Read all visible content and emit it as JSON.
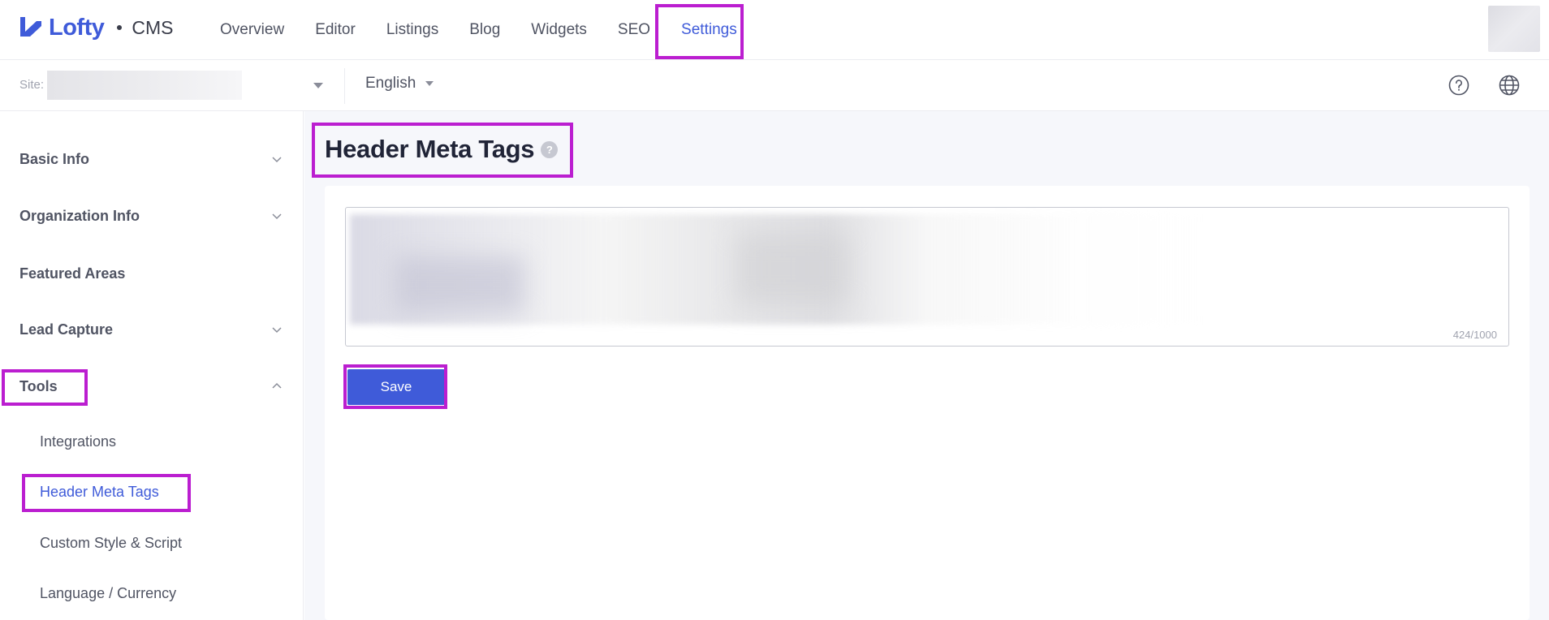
{
  "app": {
    "logo_text": "Lofty",
    "product": "CMS",
    "brand_color": "#3f5bd9",
    "highlight_color": "#bb1ed0"
  },
  "nav": {
    "items": [
      {
        "label": "Overview"
      },
      {
        "label": "Editor"
      },
      {
        "label": "Listings"
      },
      {
        "label": "Blog"
      },
      {
        "label": "Widgets"
      },
      {
        "label": "SEO"
      },
      {
        "label": "Settings",
        "active": true
      }
    ]
  },
  "subbar": {
    "site_label": "Site:",
    "language": "English",
    "help_icon": "help-circle-icon",
    "globe_icon": "globe-icon"
  },
  "sidebar": {
    "groups": [
      {
        "label": "Basic Info",
        "icon": "chevron-down-icon"
      },
      {
        "label": "Organization Info",
        "icon": "chevron-down-icon"
      },
      {
        "label": "Featured Areas"
      },
      {
        "label": "Lead Capture",
        "icon": "chevron-down-icon"
      },
      {
        "label": "Tools",
        "icon": "chevron-up-icon",
        "expanded": true
      }
    ],
    "tools_items": [
      {
        "label": "Integrations"
      },
      {
        "label": "Header Meta Tags",
        "active": true
      },
      {
        "label": "Custom Style & Script"
      },
      {
        "label": "Language / Currency"
      }
    ]
  },
  "main": {
    "title": "Header Meta Tags",
    "help_badge": "?",
    "char_count": "424/1000",
    "save_label": "Save"
  }
}
